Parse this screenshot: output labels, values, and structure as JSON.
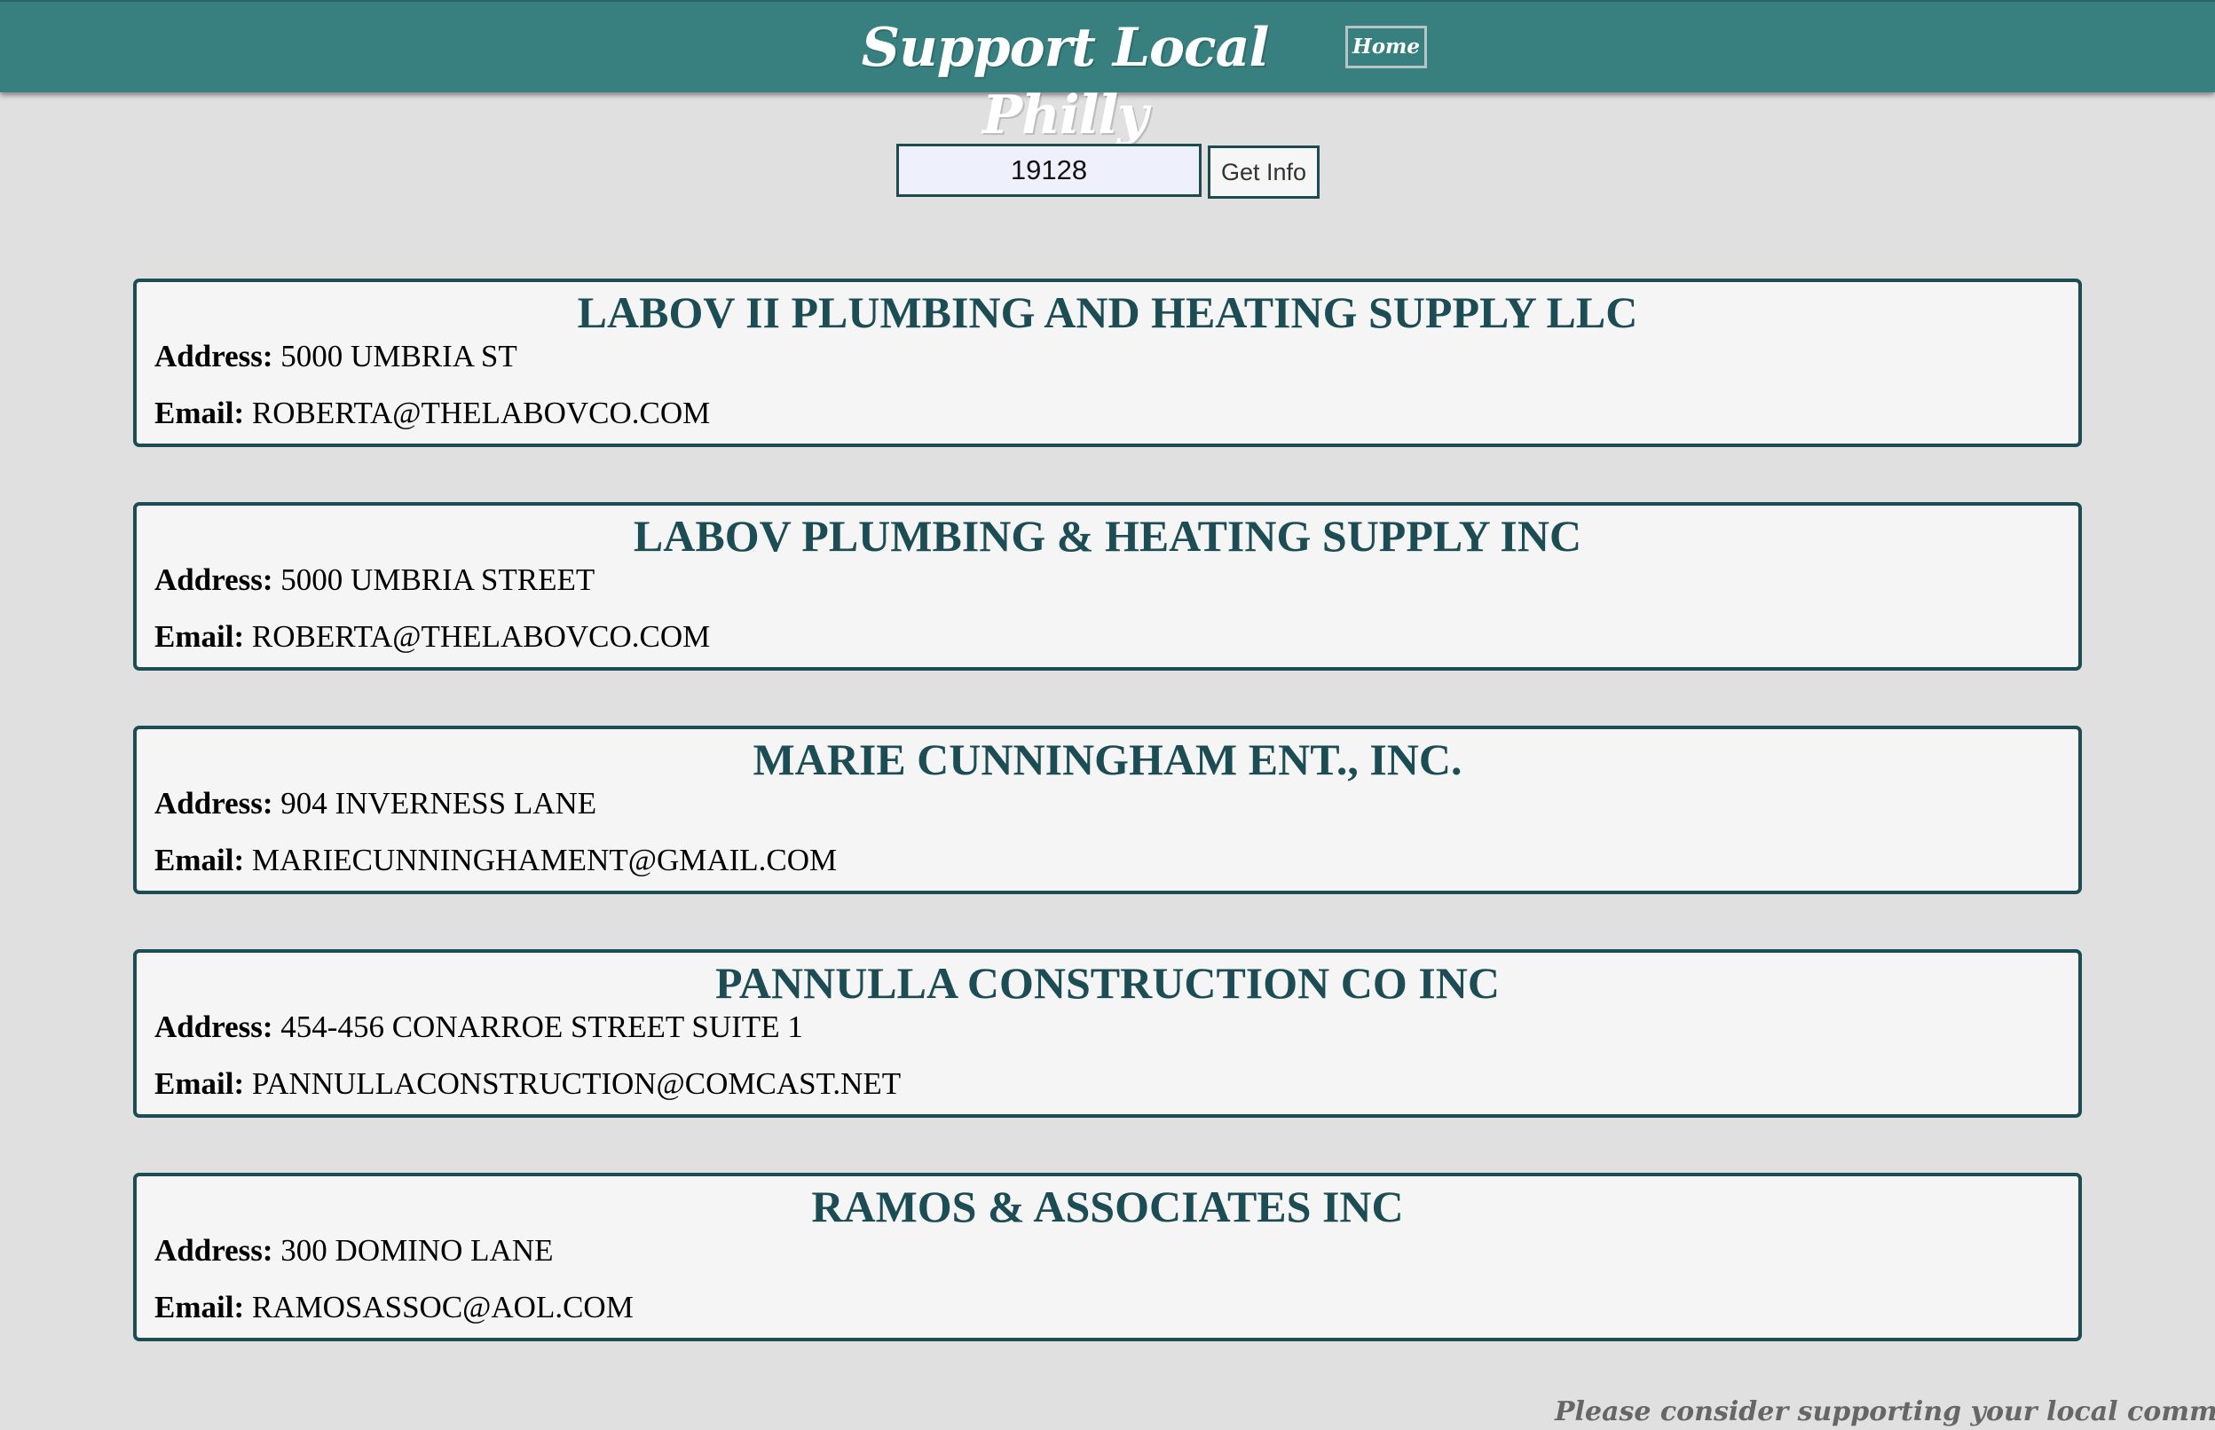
{
  "header": {
    "title": "Support Local Philly",
    "home_label": "Home"
  },
  "search": {
    "zip_value": "19128",
    "button_label": "Get Info"
  },
  "labels": {
    "address": "Address:",
    "email": "Email:"
  },
  "businesses": [
    {
      "name": "LABOV II PLUMBING AND HEATING SUPPLY LLC",
      "address": "5000 UMBRIA ST",
      "email": "ROBERTA@THELABOVCO.COM"
    },
    {
      "name": "LABOV PLUMBING & HEATING SUPPLY INC",
      "address": "5000 UMBRIA STREET",
      "email": "ROBERTA@THELABOVCO.COM"
    },
    {
      "name": "MARIE CUNNINGHAM ENT., INC.",
      "address": "904 INVERNESS LANE",
      "email": "MARIECUNNINGHAMENT@GMAIL.COM"
    },
    {
      "name": "PANNULLA CONSTRUCTION CO INC",
      "address": "454-456 CONARROE STREET SUITE 1",
      "email": "PANNULLACONSTRUCTION@COMCAST.NET"
    },
    {
      "name": "RAMOS & ASSOCIATES INC",
      "address": "300 DOMINO LANE",
      "email": "RAMOSASSOC@AOL.COM"
    }
  ],
  "footer": {
    "note": "Please consider supporting your local community"
  },
  "colors": {
    "header_bg": "#388080",
    "page_bg": "#e0e0e0",
    "card_border": "#1c4d55",
    "card_bg": "#f5f5f5"
  }
}
